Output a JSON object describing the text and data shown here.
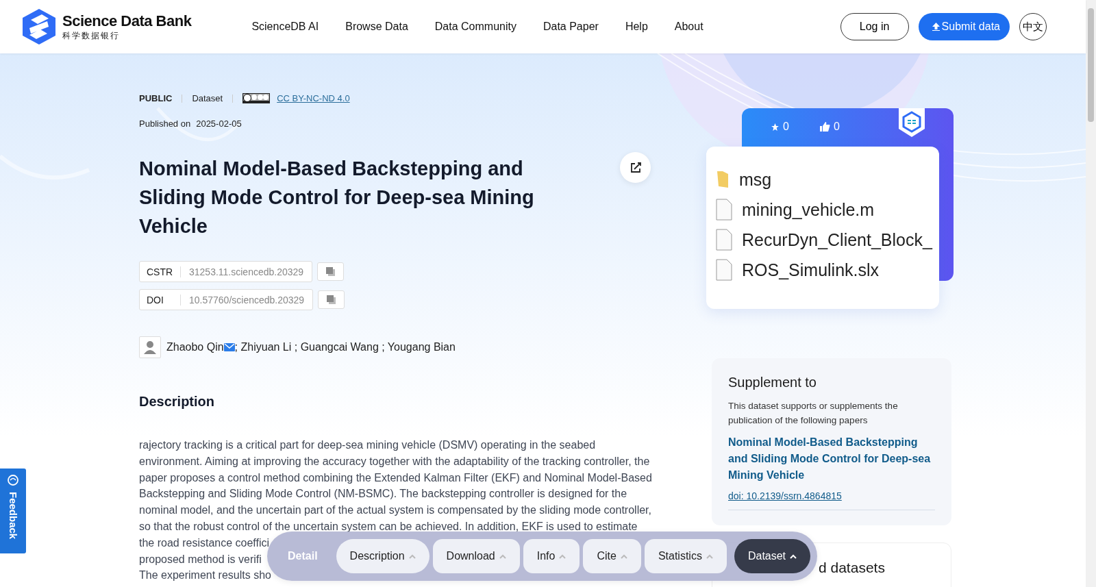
{
  "header": {
    "logo_title": "Science Data Bank",
    "logo_subtitle": "科学数据银行",
    "nav": [
      "ScienceDB AI",
      "Browse Data",
      "Data Community",
      "Data Paper",
      "Help",
      "About"
    ],
    "login": "Log in",
    "submit": "Submit data",
    "language": "中文"
  },
  "meta": {
    "access": "PUBLIC",
    "type": "Dataset",
    "license": "CC BY-NC-ND 4.0",
    "published_label": "Published on",
    "published_date": "2025-02-05"
  },
  "title": "Nominal Model-Based Backstepping and Sliding Mode Control for Deep-sea Mining Vehicle",
  "identifiers": [
    {
      "label": "CSTR",
      "value": "31253.11.sciencedb.20329"
    },
    {
      "label": "DOI",
      "value": "10.57760/sciencedb.20329"
    }
  ],
  "authors": [
    {
      "name": "Zhaobo Qin",
      "email": true
    },
    {
      "name": "; Zhiyuan Li ; Guangcai Wang ; Yougang Bian",
      "email": false
    }
  ],
  "description": {
    "heading": "Description",
    "lines": [
      "rajectory tracking is a critical part for deep-sea mining vehicle (DSMV) operating in the seabed",
      "environment. Aiming at improving the accuracy together with the adaptability of the tracking controller, the",
      "paper proposes a control method combining the Extended Kalman Filter (EKF) and Nominal Model-Based",
      "Backstepping and Sliding Mode Control (NM-BSMC). The backstepping controller is designed for the",
      "nominal model, and the uncertain part of the actual system is compensated by the sliding mode controller,",
      "so that the robust control of the uncertain system can be achieved. In addition, EKF is used to estimate",
      "the road resistance coeffici",
      "proposed method is verifi",
      "The experiment results sho"
    ]
  },
  "stats": {
    "stars": "0",
    "likes": "0"
  },
  "preview_files": [
    {
      "kind": "folder",
      "name": "msg"
    },
    {
      "kind": "file",
      "name": "mining_vehicle.m"
    },
    {
      "kind": "file",
      "name": "RecurDyn_Client_Block_"
    },
    {
      "kind": "file",
      "name": "ROS_Simulink.slx"
    }
  ],
  "supplement": {
    "heading": "Supplement to",
    "text": "This dataset supports or supplements the publication of the following papers",
    "paper_title": "Nominal Model-Based Backstepping and Sliding Mode Control for Deep-sea Mining Vehicle",
    "doi": "doi: 10.2139/ssrn.4864815"
  },
  "related": {
    "heading": "d datasets"
  },
  "feedback": "Feedback",
  "section_bar": {
    "label": "Detail",
    "tabs": [
      {
        "label": "Description",
        "selected": false
      },
      {
        "label": "Download",
        "selected": false
      },
      {
        "label": "Info",
        "selected": false
      },
      {
        "label": "Cite",
        "selected": false
      },
      {
        "label": "Statistics",
        "selected": false
      },
      {
        "label": "Dataset",
        "selected": true
      }
    ]
  }
}
